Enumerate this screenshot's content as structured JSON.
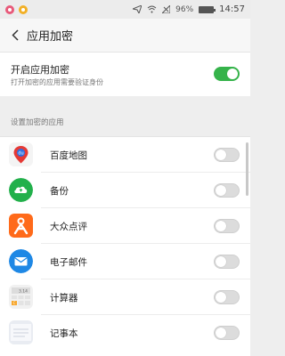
{
  "status_bar": {
    "battery_text": "96%",
    "battery_level": 0.96,
    "time": "14:57",
    "icons": [
      "notification-pink-icon",
      "notification-amber-icon",
      "send-icon",
      "wifi-icon",
      "signal-icon",
      "battery-icon"
    ]
  },
  "header": {
    "title": "应用加密"
  },
  "master": {
    "title": "开启应用加密",
    "subtitle": "打开加密的应用需要验证身份",
    "enabled": true
  },
  "section_label": "设置加密的应用",
  "apps": [
    {
      "name": "百度地图",
      "icon": "baidu-map-icon",
      "enabled": false
    },
    {
      "name": "备份",
      "icon": "backup-cloud-icon",
      "enabled": false
    },
    {
      "name": "大众点评",
      "icon": "dianping-icon",
      "enabled": false
    },
    {
      "name": "电子邮件",
      "icon": "email-icon",
      "enabled": false
    },
    {
      "name": "计算器",
      "icon": "calculator-icon",
      "enabled": false
    },
    {
      "name": "记事本",
      "icon": "notepad-icon",
      "enabled": false
    }
  ],
  "colors": {
    "toggle_on": "#35b34a",
    "toggle_off": "#dcdcdc"
  }
}
